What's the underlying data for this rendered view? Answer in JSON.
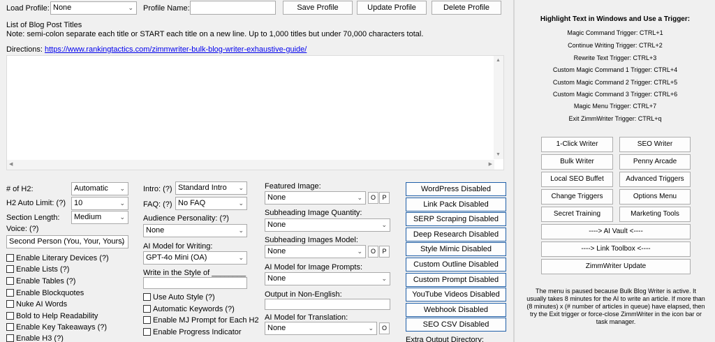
{
  "top": {
    "load_profile_label": "Load Profile:",
    "load_profile_value": "None",
    "profile_name_label": "Profile Name:",
    "save_profile": "Save Profile",
    "update_profile": "Update Profile",
    "delete_profile": "Delete Profile"
  },
  "titles": {
    "heading": "List of Blog Post Titles",
    "note": "Note: semi-colon separate each title or START each title on a new line. Up to 1,000 titles but under 70,000 characters total.",
    "directions_label": "Directions:",
    "directions_link": "https://www.rankingtactics.com/zimmwriter-bulk-blog-writer-exhaustive-guide/"
  },
  "col1": {
    "h2_count_label": "# of H2:",
    "h2_count_value": "Automatic",
    "h2_limit_label": "H2 Auto Limit: (?)",
    "h2_limit_value": "10",
    "section_length_label": "Section Length:",
    "section_length_value": "Medium",
    "voice_label": "Voice: (?)",
    "voice_value": "Second Person (You, Your, Yours)",
    "checks": [
      "Enable Literary Devices (?)",
      "Enable Lists (?)",
      "Enable Tables (?)",
      "Enable Blockquotes",
      "Nuke AI Words",
      "Bold to Help Readability",
      "Enable Key Takeaways (?)",
      "Enable H3 (?)"
    ]
  },
  "col2": {
    "intro_label": "Intro: (?)",
    "intro_value": "Standard Intro",
    "faq_label": "FAQ: (?)",
    "faq_value": "No FAQ",
    "personality_label": "Audience Personality: (?)",
    "personality_value": "None",
    "ai_model_label": "AI Model for Writing:",
    "ai_model_value": "GPT-4o Mini (OA)",
    "style_label": "Write in the Style of ________",
    "checks": [
      "Use Auto Style (?)",
      "Automatic Keywords (?)",
      "Enable MJ Prompt for Each H2",
      "Enable Progress Indicator"
    ]
  },
  "col3": {
    "featured_label": "Featured Image:",
    "featured_value": "None",
    "sub_qty_label": "Subheading Image Quantity:",
    "sub_qty_value": "None",
    "sub_model_label": "Subheading Images Model:",
    "sub_model_value": "None",
    "img_prompt_label": "AI Model for Image Prompts:",
    "img_prompt_value": "None",
    "non_english_label": "Output in Non-English:",
    "translation_label": "AI Model for Translation:",
    "translation_value": "None",
    "o": "O",
    "p": "P"
  },
  "col4": {
    "buttons": [
      "WordPress Disabled",
      "Link Pack Disabled",
      "SERP Scraping Disabled",
      "Deep Research Disabled",
      "Style Mimic Disabled",
      "Custom Outline Disabled",
      "Custom Prompt Disabled",
      "YouTube Videos Disabled",
      "Webhook Disabled",
      "SEO CSV Disabled"
    ],
    "extra_output": "Extra Output Directory:"
  },
  "right": {
    "heading": "Highlight Text in Windows and Use a Trigger:",
    "triggers": [
      "Magic Command Trigger: CTRL+1",
      "Continue Writing Trigger: CTRL+2",
      "Rewrite Text Trigger: CTRL+3",
      "Custom Magic Command 1 Trigger: CTRL+4",
      "Custom Magic Command 2 Trigger: CTRL+5",
      "Custom Magic Command 3 Trigger: CTRL+6",
      "Magic Menu Trigger: CTRL+7",
      "Exit ZimmWriter Trigger: CTRL+q"
    ],
    "grid": [
      [
        "1-Click Writer",
        "SEO Writer"
      ],
      [
        "Bulk Writer",
        "Penny Arcade"
      ],
      [
        "Local SEO Buffet",
        "Advanced Triggers"
      ],
      [
        "Change Triggers",
        "Options Menu"
      ],
      [
        "Secret Training",
        "Marketing Tools"
      ]
    ],
    "ai_vault": "----> AI Vault <----",
    "link_toolbox": "----> Link Toolbox <----",
    "update": "ZimmWriter Update",
    "paused_note": "The menu is paused because Bulk Blog Writer is active. It usually takes 8 minutes for the AI to write an article. If more than (8 minutes) x (# number of articles in queue) have elapsed, then try the Exit trigger or force-close ZimmWriter in the icon bar or task manager."
  }
}
